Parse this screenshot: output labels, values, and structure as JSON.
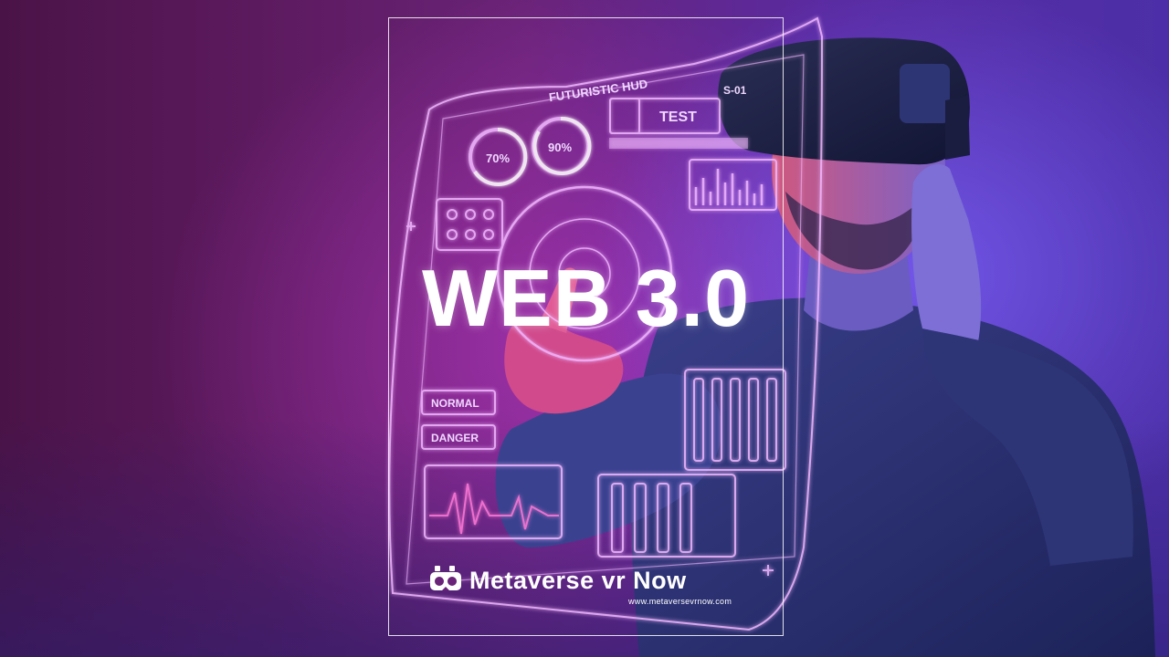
{
  "title": "WEB 3.0",
  "brand": {
    "name": "Metaverse vr Now",
    "url": "www.metaversevrnow.com"
  },
  "hud": {
    "header": "FUTURISTIC HUD",
    "percent_left": "70%",
    "percent_right": "90%",
    "test_label": "TEST",
    "code_label": "S-01",
    "normal_label": "NORMAL",
    "danger_label": "DANGER"
  },
  "colors": {
    "frame": "#ffffff",
    "title": "#ffffff",
    "hud_glow": "#f2b8ff",
    "background_magenta": "#5c1a5e",
    "background_blue": "#4c2fa8"
  }
}
